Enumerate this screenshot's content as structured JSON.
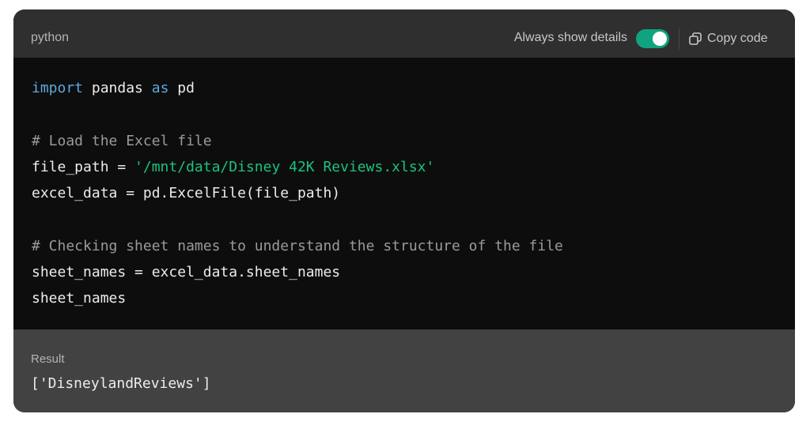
{
  "header": {
    "language": "python",
    "always_show_details_label": "Always show details",
    "always_show_details_on": true,
    "copy_label": "Copy code",
    "copy_icon": "copy-icon"
  },
  "code": {
    "lines": [
      [
        {
          "t": "import",
          "c": "kw"
        },
        {
          "t": " pandas "
        },
        {
          "t": "as",
          "c": "kw"
        },
        {
          "t": " pd"
        }
      ],
      [],
      [
        {
          "t": "# Load the Excel file",
          "c": "cmt"
        }
      ],
      [
        {
          "t": "file_path = "
        },
        {
          "t": "'/mnt/data/Disney 42K Reviews.xlsx'",
          "c": "str"
        }
      ],
      [
        {
          "t": "excel_data = pd.ExcelFile(file_path)"
        }
      ],
      [],
      [
        {
          "t": "# Checking sheet names to understand the structure of the file",
          "c": "cmt"
        }
      ],
      [
        {
          "t": "sheet_names = excel_data.sheet_names"
        }
      ],
      [
        {
          "t": "sheet_names"
        }
      ]
    ]
  },
  "result": {
    "label": "Result",
    "value": "['DisneylandReviews']"
  },
  "colors": {
    "keyword": "#5fa8de",
    "string": "#19c37d",
    "comment": "#9a9a9a",
    "toggle_on": "#10a37f"
  }
}
